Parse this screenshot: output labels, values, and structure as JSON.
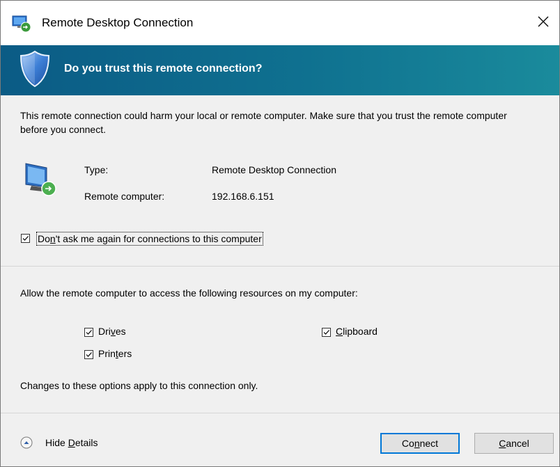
{
  "window": {
    "title": "Remote Desktop Connection",
    "close_glyph": "✕"
  },
  "banner": {
    "text": "Do you trust this remote connection?"
  },
  "warning": {
    "text": "This remote connection could harm your local or remote computer. Make sure that you trust the remote computer before you connect."
  },
  "info": {
    "type_label": "Type:",
    "type_value": "Remote Desktop Connection",
    "computer_label": "Remote computer:",
    "computer_value": "192.168.6.151"
  },
  "dont_ask": {
    "checked": true,
    "label_pre": "Do",
    "label_accel": "n",
    "label_post": "'t ask me again for connections to this computer"
  },
  "resources": {
    "intro": "Allow the remote computer to access the following resources on my computer:",
    "drives": {
      "checked": true,
      "pre": "Dri",
      "accel": "v",
      "post": "es"
    },
    "clipboard": {
      "checked": true,
      "pre": "",
      "accel": "C",
      "post": "lipboard"
    },
    "printers": {
      "checked": true,
      "pre": "Prin",
      "accel": "t",
      "post": "ers"
    },
    "note": "Changes to these options apply to this connection only."
  },
  "footer": {
    "details_pre": "Hide ",
    "details_accel": "D",
    "details_post": "etails",
    "connect_pre": "Co",
    "connect_accel": "n",
    "connect_post": "nect",
    "cancel_pre": "",
    "cancel_accel": "C",
    "cancel_post": "ancel"
  },
  "colors": {
    "banner_start": "#0b5b85",
    "banner_end": "#1a8b9c",
    "default_button_border": "#0078d7",
    "dialog_background": "#f0f0f0"
  },
  "icons": {
    "app": "remote-desktop-icon",
    "close": "close-icon",
    "shield": "shield-icon",
    "computer": "remote-computer-icon",
    "details": "chevron-up-circle-icon"
  }
}
